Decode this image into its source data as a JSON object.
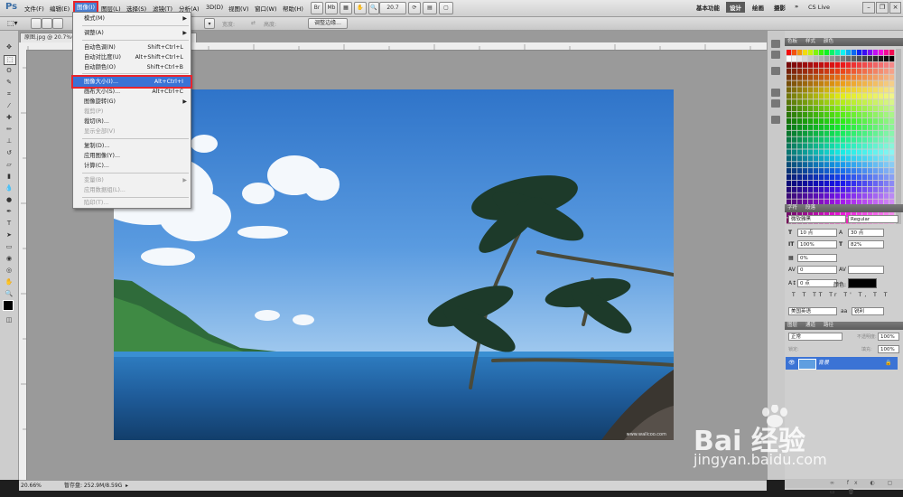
{
  "app": {
    "logo": "Ps"
  },
  "menubar": {
    "items": [
      "文件(F)",
      "编辑(E)",
      "图像(I)",
      "图层(L)",
      "选择(S)",
      "滤镜(T)",
      "分析(A)",
      "3D(D)",
      "视图(V)",
      "窗口(W)",
      "帮助(H)"
    ],
    "zoom": "20.7",
    "workspaces": [
      "基本功能",
      "设计",
      "绘画",
      "摄影"
    ],
    "cs_live": "CS Live"
  },
  "optionsbar": {
    "adjust_edge": "调整边缘..."
  },
  "document": {
    "tab_title": "原图.jpg @ 20.7%(RGB/8)",
    "status_zoom": "20.66%",
    "status_info": "暂存盘: 252.9M/8.59G",
    "photo_credit": "www.wallcoo.com"
  },
  "image_menu": {
    "items": [
      {
        "label": "模式(M)",
        "shortcut": "",
        "submenu": true,
        "disabled": false
      },
      {
        "label": "调整(A)",
        "shortcut": "",
        "submenu": true,
        "disabled": false
      },
      {
        "label": "自动色调(N)",
        "shortcut": "Shift+Ctrl+L",
        "submenu": false,
        "disabled": false
      },
      {
        "label": "自动对比度(U)",
        "shortcut": "Alt+Shift+Ctrl+L",
        "submenu": false,
        "disabled": false
      },
      {
        "label": "自动颜色(O)",
        "shortcut": "Shift+Ctrl+B",
        "submenu": false,
        "disabled": false
      },
      {
        "label": "图像大小(I)...",
        "shortcut": "Alt+Ctrl+I",
        "submenu": false,
        "disabled": false,
        "highlighted": true
      },
      {
        "label": "画布大小(S)...",
        "shortcut": "Alt+Ctrl+C",
        "submenu": false,
        "disabled": false
      },
      {
        "label": "图像旋转(G)",
        "shortcut": "",
        "submenu": true,
        "disabled": false
      },
      {
        "label": "裁剪(P)",
        "shortcut": "",
        "submenu": false,
        "disabled": true
      },
      {
        "label": "裁切(R)...",
        "shortcut": "",
        "submenu": false,
        "disabled": false
      },
      {
        "label": "显示全部(V)",
        "shortcut": "",
        "submenu": false,
        "disabled": true
      },
      {
        "label": "复制(D)...",
        "shortcut": "",
        "submenu": false,
        "disabled": false
      },
      {
        "label": "应用图像(Y)...",
        "shortcut": "",
        "submenu": false,
        "disabled": false
      },
      {
        "label": "计算(C)...",
        "shortcut": "",
        "submenu": false,
        "disabled": false
      },
      {
        "label": "变量(B)",
        "shortcut": "",
        "submenu": true,
        "disabled": true
      },
      {
        "label": "应用数据组(L)...",
        "shortcut": "",
        "submenu": false,
        "disabled": true
      },
      {
        "label": "陷印(T)...",
        "shortcut": "",
        "submenu": false,
        "disabled": true
      }
    ]
  },
  "panels": {
    "swatches_tabs": [
      "色板",
      "样式",
      "颜色"
    ],
    "character_tabs": [
      "字符",
      "段落"
    ],
    "font_family": "微软雅黑",
    "font_style": "Regular",
    "font_size": "10 点",
    "leading": "30 点",
    "vscale": "100%",
    "hscale": "82%",
    "tracking": "0%",
    "kerning": "0",
    "baseline": "0 点",
    "color_label": "颜色:",
    "language": "美国英语",
    "antialias": "锐利",
    "layers_tabs": [
      "图层",
      "通道",
      "路径"
    ],
    "blend_mode": "正常",
    "opacity_label": "不透明度:",
    "opacity": "100%",
    "fill_label": "填充:",
    "fill": "100%",
    "lock_label": "锁定:",
    "layer_name": "背景"
  },
  "watermark": {
    "brand": "Bai 经验",
    "url": "jingyan.baidu.com"
  }
}
